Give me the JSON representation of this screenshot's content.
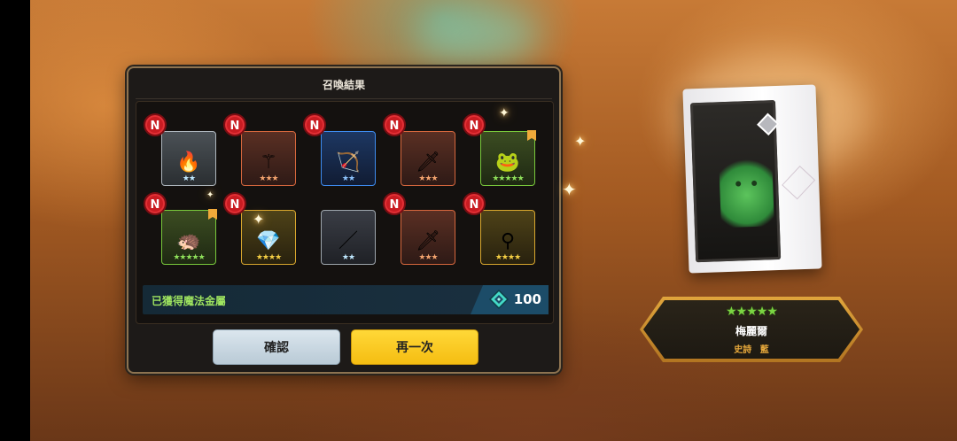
{
  "dialog": {
    "title": "召喚結果",
    "status_text": "已獲得魔法金屬",
    "currency_value": "100",
    "confirm_label": "確認",
    "again_label": "再一次"
  },
  "items": [
    {
      "rarity": "white",
      "stars": "★★",
      "stars_count": 2,
      "new": "N",
      "icon": "fire-orb-icon",
      "glyph": "🔥",
      "star_color": "#bfe8ff"
    },
    {
      "rarity": "orange",
      "stars": "★★★",
      "stars_count": 3,
      "new": "N",
      "icon": "ice-staff-icon",
      "glyph": "⚚",
      "star_color": "#f3a36e"
    },
    {
      "rarity": "blue",
      "stars": "★★",
      "stars_count": 2,
      "new": "N",
      "icon": "bow-icon",
      "glyph": "🏹",
      "star_color": "#8ec5ff"
    },
    {
      "rarity": "orange",
      "stars": "★★★",
      "stars_count": 3,
      "new": "N",
      "icon": "blue-blade-icon",
      "glyph": "🗡",
      "star_color": "#f3a36e"
    },
    {
      "rarity": "green",
      "stars": "★★★★★",
      "stars_count": 5,
      "new": "N",
      "icon": "green-creature-icon",
      "glyph": "🐸",
      "star_color": "#8ee05a",
      "bookmark": true
    },
    {
      "rarity": "green",
      "stars": "★★★★★",
      "stars_count": 5,
      "new": "N",
      "icon": "red-beast-icon",
      "glyph": "🦔",
      "star_color": "#8ee05a",
      "bookmark": true
    },
    {
      "rarity": "yellow",
      "stars": "★★★★",
      "stars_count": 4,
      "new": "N",
      "icon": "crystal-gauntlet-icon",
      "glyph": "💎",
      "star_color": "#f5cf44"
    },
    {
      "rarity": "gray",
      "stars": "★★",
      "stars_count": 2,
      "new": "",
      "icon": "purple-wand-icon",
      "glyph": "／",
      "star_color": "#bfe8ff"
    },
    {
      "rarity": "orange",
      "stars": "★★★",
      "stars_count": 3,
      "new": "N",
      "icon": "great-sword-icon",
      "glyph": "🗡",
      "star_color": "#f3a36e"
    },
    {
      "rarity": "yellow",
      "stars": "★★★★",
      "stars_count": 4,
      "new": "N",
      "icon": "dark-staff-icon",
      "glyph": "⚲",
      "star_color": "#f5cf44"
    }
  ],
  "hero": {
    "stars": "★★★★★",
    "stars_count": 5,
    "name": "梅麗爾",
    "grade": "史詩",
    "element": "藍"
  },
  "colors": {
    "confirm": "#c9d8e3",
    "again": "#f8c81f",
    "status_text": "#9ee35f",
    "new_badge": "#c91c22",
    "plate_border": "#d99a34"
  }
}
